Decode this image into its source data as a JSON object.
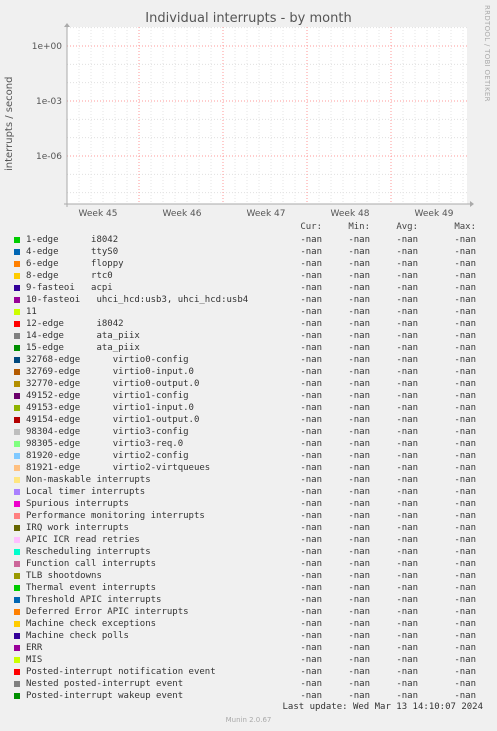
{
  "chart_data": {
    "type": "line",
    "title": "Individual interrupts - by month",
    "ylabel": "interrupts / second",
    "yscale": "log",
    "yticks": [
      "1e+00",
      "1e-03",
      "1e-06"
    ],
    "xticks": [
      "Week 45",
      "Week 46",
      "Week 47",
      "Week 48",
      "Week 49"
    ],
    "grid": true,
    "series_values": "-nan"
  },
  "side_credit": "RRDTOOL / TOBI OETIKER",
  "legend_header": {
    "cur": "Cur:",
    "min": "Min:",
    "avg": "Avg:",
    "max": "Max:"
  },
  "legend": [
    {
      "name": "1-edge      i8042",
      "color": "#00cc00",
      "cur": "-nan",
      "min": "-nan",
      "avg": "-nan",
      "max": "-nan"
    },
    {
      "name": "4-edge      ttyS0",
      "color": "#0066b3",
      "cur": "-nan",
      "min": "-nan",
      "avg": "-nan",
      "max": "-nan"
    },
    {
      "name": "6-edge      floppy",
      "color": "#ff8000",
      "cur": "-nan",
      "min": "-nan",
      "avg": "-nan",
      "max": "-nan"
    },
    {
      "name": "8-edge      rtc0",
      "color": "#ffcc00",
      "cur": "-nan",
      "min": "-nan",
      "avg": "-nan",
      "max": "-nan"
    },
    {
      "name": "9-fasteoi   acpi",
      "color": "#330099",
      "cur": "-nan",
      "min": "-nan",
      "avg": "-nan",
      "max": "-nan"
    },
    {
      "name": "10-fasteoi   uhci_hcd:usb3, uhci_hcd:usb4",
      "color": "#990099",
      "cur": "-nan",
      "min": "-nan",
      "avg": "-nan",
      "max": "-nan"
    },
    {
      "name": "11",
      "color": "#ccff00",
      "cur": "-nan",
      "min": "-nan",
      "avg": "-nan",
      "max": "-nan"
    },
    {
      "name": "12-edge      i8042",
      "color": "#ff0000",
      "cur": "-nan",
      "min": "-nan",
      "avg": "-nan",
      "max": "-nan"
    },
    {
      "name": "14-edge      ata_piix",
      "color": "#808080",
      "cur": "-nan",
      "min": "-nan",
      "avg": "-nan",
      "max": "-nan"
    },
    {
      "name": "15-edge      ata_piix",
      "color": "#008f00",
      "cur": "-nan",
      "min": "-nan",
      "avg": "-nan",
      "max": "-nan"
    },
    {
      "name": "32768-edge      virtio0-config",
      "color": "#00487d",
      "cur": "-nan",
      "min": "-nan",
      "avg": "-nan",
      "max": "-nan"
    },
    {
      "name": "32769-edge      virtio0-input.0",
      "color": "#b35a00",
      "cur": "-nan",
      "min": "-nan",
      "avg": "-nan",
      "max": "-nan"
    },
    {
      "name": "32770-edge      virtio0-output.0",
      "color": "#b38f00",
      "cur": "-nan",
      "min": "-nan",
      "avg": "-nan",
      "max": "-nan"
    },
    {
      "name": "49152-edge      virtio1-config",
      "color": "#6b006b",
      "cur": "-nan",
      "min": "-nan",
      "avg": "-nan",
      "max": "-nan"
    },
    {
      "name": "49153-edge      virtio1-input.0",
      "color": "#8fb300",
      "cur": "-nan",
      "min": "-nan",
      "avg": "-nan",
      "max": "-nan"
    },
    {
      "name": "49154-edge      virtio1-output.0",
      "color": "#b30000",
      "cur": "-nan",
      "min": "-nan",
      "avg": "-nan",
      "max": "-nan"
    },
    {
      "name": "98304-edge      virtio3-config",
      "color": "#bebebe",
      "cur": "-nan",
      "min": "-nan",
      "avg": "-nan",
      "max": "-nan"
    },
    {
      "name": "98305-edge      virtio3-req.0",
      "color": "#80ff80",
      "cur": "-nan",
      "min": "-nan",
      "avg": "-nan",
      "max": "-nan"
    },
    {
      "name": "81920-edge      virtio2-config",
      "color": "#80c9ff",
      "cur": "-nan",
      "min": "-nan",
      "avg": "-nan",
      "max": "-nan"
    },
    {
      "name": "81921-edge      virtio2-virtqueues",
      "color": "#ffc080",
      "cur": "-nan",
      "min": "-nan",
      "avg": "-nan",
      "max": "-nan"
    },
    {
      "name": "Non-maskable interrupts",
      "color": "#ffe680",
      "cur": "-nan",
      "min": "-nan",
      "avg": "-nan",
      "max": "-nan"
    },
    {
      "name": "Local timer interrupts",
      "color": "#aa80ff",
      "cur": "-nan",
      "min": "-nan",
      "avg": "-nan",
      "max": "-nan"
    },
    {
      "name": "Spurious interrupts",
      "color": "#ee00cc",
      "cur": "-nan",
      "min": "-nan",
      "avg": "-nan",
      "max": "-nan"
    },
    {
      "name": "Performance monitoring interrupts",
      "color": "#ff8080",
      "cur": "-nan",
      "min": "-nan",
      "avg": "-nan",
      "max": "-nan"
    },
    {
      "name": "IRQ work interrupts",
      "color": "#666600",
      "cur": "-nan",
      "min": "-nan",
      "avg": "-nan",
      "max": "-nan"
    },
    {
      "name": "APIC ICR read retries",
      "color": "#ffbfff",
      "cur": "-nan",
      "min": "-nan",
      "avg": "-nan",
      "max": "-nan"
    },
    {
      "name": "Rescheduling interrupts",
      "color": "#00ffcc",
      "cur": "-nan",
      "min": "-nan",
      "avg": "-nan",
      "max": "-nan"
    },
    {
      "name": "Function call interrupts",
      "color": "#cc6699",
      "cur": "-nan",
      "min": "-nan",
      "avg": "-nan",
      "max": "-nan"
    },
    {
      "name": "TLB shootdowns",
      "color": "#999900",
      "cur": "-nan",
      "min": "-nan",
      "avg": "-nan",
      "max": "-nan"
    },
    {
      "name": "Thermal event interrupts",
      "color": "#00cc00",
      "cur": "-nan",
      "min": "-nan",
      "avg": "-nan",
      "max": "-nan"
    },
    {
      "name": "Threshold APIC interrupts",
      "color": "#0066b3",
      "cur": "-nan",
      "min": "-nan",
      "avg": "-nan",
      "max": "-nan"
    },
    {
      "name": "Deferred Error APIC interrupts",
      "color": "#ff8000",
      "cur": "-nan",
      "min": "-nan",
      "avg": "-nan",
      "max": "-nan"
    },
    {
      "name": "Machine check exceptions",
      "color": "#ffcc00",
      "cur": "-nan",
      "min": "-nan",
      "avg": "-nan",
      "max": "-nan"
    },
    {
      "name": "Machine check polls",
      "color": "#330099",
      "cur": "-nan",
      "min": "-nan",
      "avg": "-nan",
      "max": "-nan"
    },
    {
      "name": "ERR",
      "color": "#990099",
      "cur": "-nan",
      "min": "-nan",
      "avg": "-nan",
      "max": "-nan"
    },
    {
      "name": "MIS",
      "color": "#ccff00",
      "cur": "-nan",
      "min": "-nan",
      "avg": "-nan",
      "max": "-nan"
    },
    {
      "name": "Posted-interrupt notification event",
      "color": "#ff0000",
      "cur": "-nan",
      "min": "-nan",
      "avg": "-nan",
      "max": "-nan"
    },
    {
      "name": "Nested posted-interrupt event",
      "color": "#808080",
      "cur": "-nan",
      "min": "-nan",
      "avg": "-nan",
      "max": "-nan"
    },
    {
      "name": "Posted-interrupt wakeup event",
      "color": "#008f00",
      "cur": "-nan",
      "min": "-nan",
      "avg": "-nan",
      "max": "-nan"
    }
  ],
  "last_update": "Last update: Wed Mar 13 14:10:07 2024",
  "footer": "Munin 2.0.67"
}
